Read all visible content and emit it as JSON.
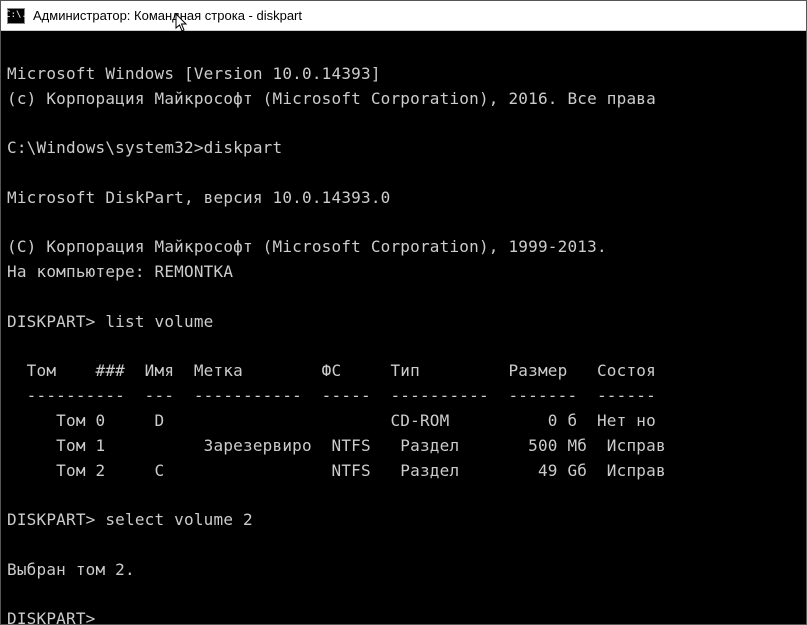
{
  "window": {
    "title": "Администратор: Командная строка - diskpart",
    "icon_label": "C:\\."
  },
  "console": {
    "lines": {
      "l1": "Microsoft Windows [Version 10.0.14393]",
      "l2": "(c) Корпорация Майкрософт (Microsoft Corporation), 2016. Все права",
      "l3": "",
      "l4": "C:\\Windows\\system32>diskpart",
      "l5": "",
      "l6": "Microsoft DiskPart, версия 10.0.14393.0",
      "l7": "",
      "l8": "(C) Корпорация Майкрософт (Microsoft Corporation), 1999-2013.",
      "l9": "На компьютере: REMONTKA",
      "l10": "",
      "l11": "DISKPART> list volume",
      "l12": "",
      "l13": "  Том    ###  Имя  Метка        ФС     Тип         Размер   Состоя",
      "l14": "  ----------  ---  -----------  -----  ----------  -------  ------",
      "l15": "     Том 0     D                       CD-ROM          0 б  Нет но",
      "l16": "     Том 1          Зарезервиро  NTFS   Раздел       500 Mб  Исправ",
      "l17": "     Том 2     C                 NTFS   Раздел        49 Gб  Исправ",
      "l18": "",
      "l19": "DISKPART> select volume 2",
      "l20": "",
      "l21": "Выбран том 2.",
      "l22": "",
      "l23": "DISKPART>"
    },
    "table": {
      "headers": [
        "Том",
        "###",
        "Имя",
        "Метка",
        "ФС",
        "Тип",
        "Размер",
        "Состоя"
      ],
      "rows": [
        {
          "vol": "Том 0",
          "letter": "D",
          "label": "",
          "fs": "",
          "type": "CD-ROM",
          "size": "0 б",
          "status": "Нет но"
        },
        {
          "vol": "Том 1",
          "letter": "",
          "label": "Зарезервиро",
          "fs": "NTFS",
          "type": "Раздел",
          "size": "500 Mб",
          "status": "Исправ"
        },
        {
          "vol": "Том 2",
          "letter": "C",
          "label": "",
          "fs": "NTFS",
          "type": "Раздел",
          "size": "49 Gб",
          "status": "Исправ"
        }
      ]
    },
    "commands": {
      "prompt1": "C:\\Windows\\system32>",
      "cmd1": "diskpart",
      "dp_prompt": "DISKPART>",
      "cmd2": "list volume",
      "cmd3": "select volume 2",
      "response": "Выбран том 2."
    }
  }
}
